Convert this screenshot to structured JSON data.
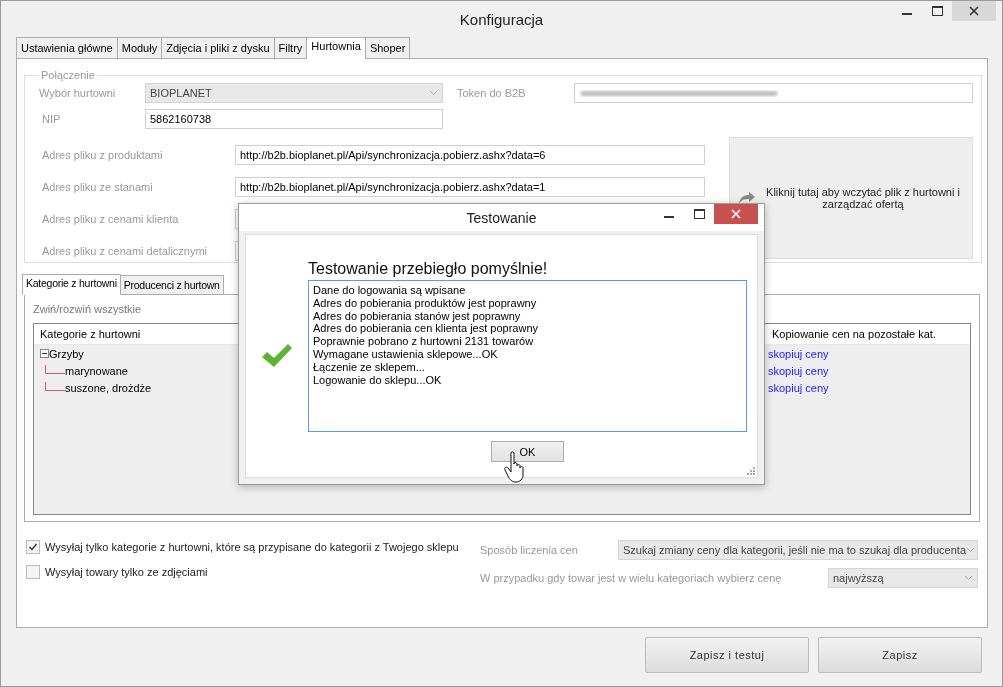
{
  "window": {
    "title": "Konfiguracja"
  },
  "tabs": [
    {
      "label": "Ustawienia główne",
      "selected": false
    },
    {
      "label": "Moduły",
      "selected": false
    },
    {
      "label": "Zdjęcia i pliki z dysku",
      "selected": false
    },
    {
      "label": "Filtry",
      "selected": false
    },
    {
      "label": "Hurtownia",
      "selected": true
    },
    {
      "label": "Shoper",
      "selected": false
    }
  ],
  "connection": {
    "title": "Połączenie",
    "wholesaler_label": "Wybór hurtowni",
    "wholesaler_value": "BIOPLANET",
    "token_label": "Token do B2B",
    "nip_label": "NIP",
    "nip_value": "5862160738",
    "addresses": [
      {
        "label": "Adres pliku z produktami",
        "value": "http://b2b.bioplanet.pl/Api/synchronizacja.pobierz.ashx?data=6"
      },
      {
        "label": "Adres pliku ze stanami",
        "value": "http://b2b.bioplanet.pl/Api/synchronizacja.pobierz.ashx?data=1"
      },
      {
        "label": "Adres pliku z cenami klienta"
      },
      {
        "label": "Adres pliku z cenami detalicznymi"
      }
    ],
    "load_panel_text": "Kliknij tutaj aby wczytać plik z hurtowni i zarządzać ofertą"
  },
  "inner_tabs": [
    {
      "label": "Kategorie z hurtowni",
      "selected": true
    },
    {
      "label": "Producenci z hurtown",
      "selected": false
    }
  ],
  "collapse_link": "Zwiń/rozwiń wszystkie",
  "tree_columns": [
    "Kategorie z hurtowni",
    "Kopiowanie cen na pozostałe kat."
  ],
  "tree": [
    {
      "label": "Grzyby",
      "expanded": true,
      "copy_link": "skopiuj ceny",
      "children": [
        {
          "label": "marynowane",
          "copy_link": "skopiuj ceny"
        },
        {
          "label": "suszone, drożdże",
          "copy_link": "skopiuj ceny"
        }
      ]
    }
  ],
  "options": [
    {
      "label": "Wysyłaj tylko kategorie z hurtowni, które są przypisane do kategorii z Twojego sklepu",
      "checked": true
    },
    {
      "label": "Wysyłaj towary tylko ze zdjęciami",
      "checked": false
    }
  ],
  "price_method": {
    "label": "Sposób liczenia cen",
    "value": "Szukaj zmiany ceny dla kategorii, jeśli nie ma to szukaj dla producenta"
  },
  "multi_category": {
    "label": "W przypadku gdy towar jest w wielu kategoriach wybierz cenę",
    "value": "najwyższą"
  },
  "buttons": [
    "Zapisz i testuj",
    "Zapisz"
  ],
  "dialog": {
    "title": "Testowanie",
    "heading": "Testowanie przebiegło pomyślnie!",
    "log": [
      "Dane do logowania są wpisane",
      "Adres do pobierania produktów jest poprawny",
      "Adres do pobierania stanów jest poprawny",
      "Adres do pobierania cen klienta jest poprawny",
      "Poprawnie pobrano z hurtowni 2131 towarów",
      "Wymagane ustawienia sklepowe...OK",
      "Łączenie ze sklepem...",
      "Logowanie do sklepu...OK"
    ],
    "ok_button": "OK"
  }
}
